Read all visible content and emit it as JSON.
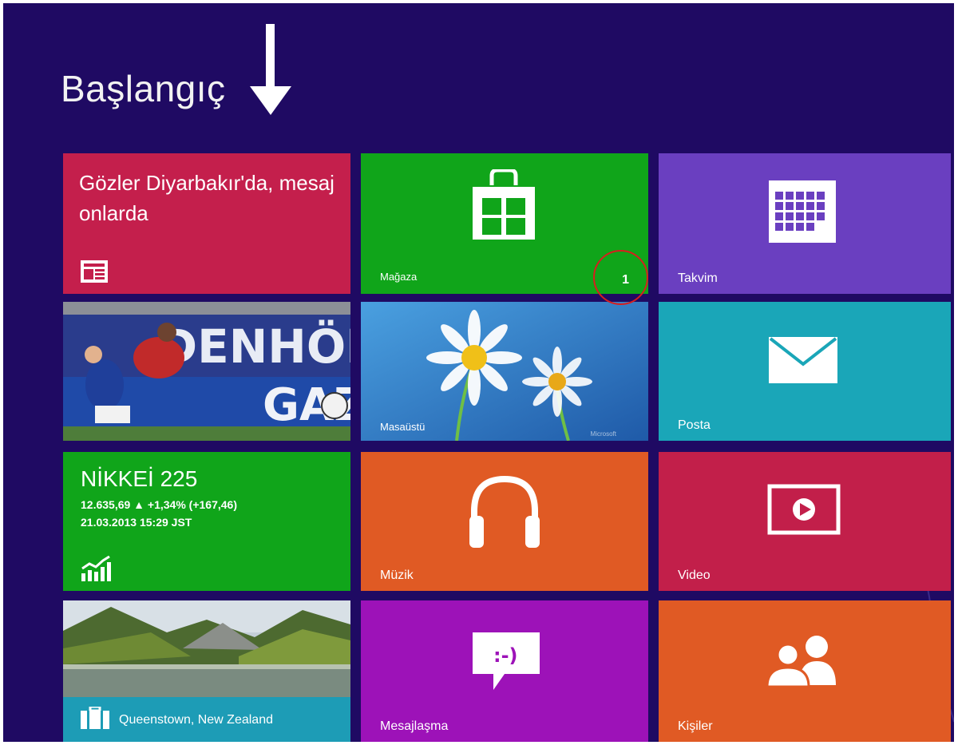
{
  "start": {
    "title": "Başlangıç"
  },
  "tiles": {
    "news": {
      "headline": "Gözler Diyarbakır'da, mesaj onlarda"
    },
    "store": {
      "label": "Mağaza",
      "badge": "1"
    },
    "calendar": {
      "label": "Takvim"
    },
    "sports": {},
    "desktop": {
      "label": "Masaüstü",
      "watermark": "Microsoft"
    },
    "mail": {
      "label": "Posta"
    },
    "finance": {
      "name": "NİKKEİ 225",
      "quote": "12.635,69 ▲ +1,34% (+167,46)",
      "date": "21.03.2013 15:29 JST"
    },
    "music": {
      "label": "Müzik"
    },
    "video": {
      "label": "Video"
    },
    "travel": {
      "label": "Queenstown, New Zealand"
    },
    "messaging": {
      "label": "Mesajlaşma"
    },
    "people": {
      "label": "Kişiler"
    }
  },
  "colors": {
    "background": "#1f0a63",
    "news": "#c41f4c",
    "store": "#10a51a",
    "calendar": "#6a3fc0",
    "mail": "#1aa6b8",
    "finance": "#10a51a",
    "music": "#e05a24",
    "video": "#c21f4a",
    "travel": "#1d9cb6",
    "messaging": "#9d12b8",
    "people": "#e05a24"
  },
  "icons": {
    "news": "news-icon",
    "store": "store-bag-icon",
    "calendar": "calendar-icon",
    "mail": "mail-icon",
    "finance": "finance-chart-icon",
    "music": "headphones-icon",
    "video": "video-play-icon",
    "travel": "suitcase-icon",
    "messaging": "chat-bubble-icon",
    "people": "people-icon"
  }
}
